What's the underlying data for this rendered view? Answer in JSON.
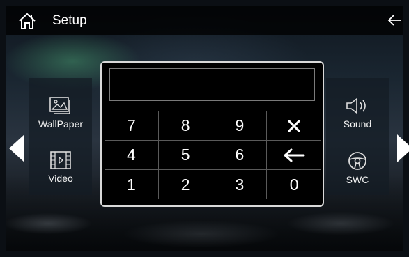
{
  "header": {
    "title": "Setup",
    "home_icon": "home-icon",
    "back_icon": "arrow-left-icon"
  },
  "tiles_left": [
    {
      "label": "WallPaper",
      "icon": "wallpaper-image-icon"
    },
    {
      "label": "Video",
      "icon": "video-film-icon"
    }
  ],
  "tiles_right": [
    {
      "label": "Sound",
      "icon": "speaker-icon"
    },
    {
      "label": "SWC",
      "icon": "steering-wheel-icon"
    }
  ],
  "keypad": {
    "display_value": "",
    "keys": [
      {
        "label": "7",
        "type": "digit"
      },
      {
        "label": "8",
        "type": "digit"
      },
      {
        "label": "9",
        "type": "digit"
      },
      {
        "label": "",
        "type": "clear",
        "icon": "close-x-icon"
      },
      {
        "label": "4",
        "type": "digit"
      },
      {
        "label": "5",
        "type": "digit"
      },
      {
        "label": "6",
        "type": "digit"
      },
      {
        "label": "",
        "type": "backspace",
        "icon": "arrow-left-icon"
      },
      {
        "label": "1",
        "type": "digit"
      },
      {
        "label": "2",
        "type": "digit"
      },
      {
        "label": "3",
        "type": "digit"
      },
      {
        "label": "0",
        "type": "digit"
      }
    ]
  },
  "colors": {
    "keypad_border": "#d9d9d9",
    "header_bg": "#000000",
    "text": "#ffffff"
  }
}
